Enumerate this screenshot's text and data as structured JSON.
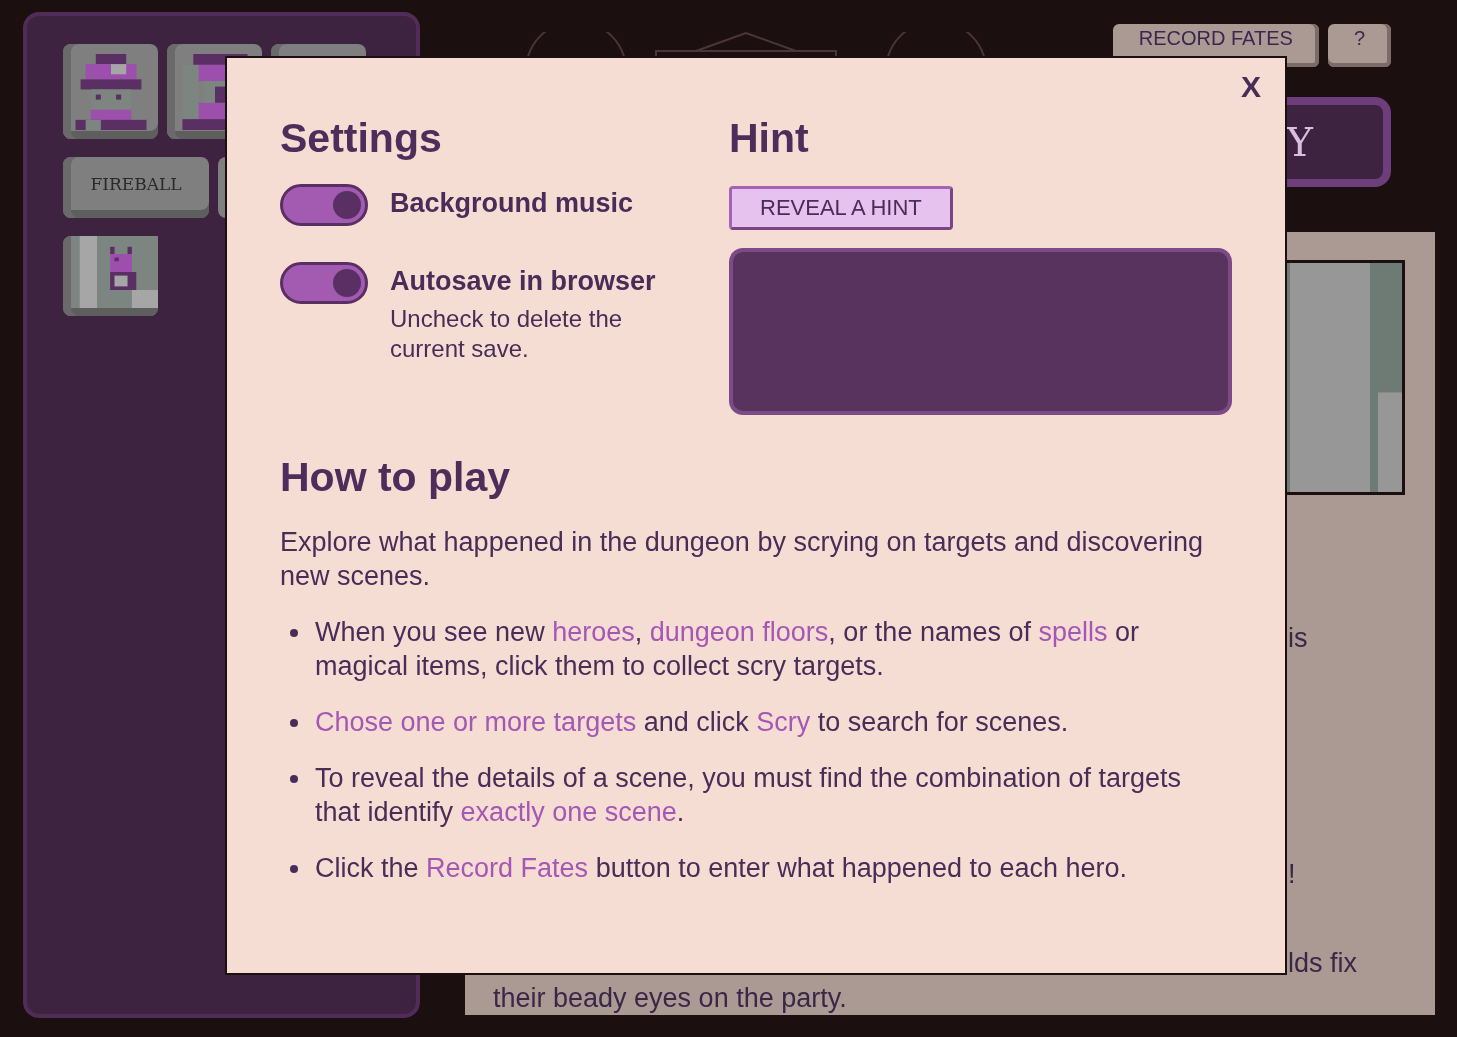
{
  "sidebar": {
    "hero_tiles": [
      {
        "kind": "mage"
      },
      {
        "kind": "knight"
      },
      {
        "kind": "blank"
      }
    ],
    "spell_buttons": [
      "FIREBALL"
    ],
    "scene_tiles": [
      {
        "kind": "cat"
      }
    ]
  },
  "top_buttons": [
    "RECORD FATES",
    "?"
  ],
  "scry_button": "Y",
  "story": {
    "fragments": [
      "is",
      "!",
      "lds fix"
    ],
    "last_line": "their beady eyes on the party."
  },
  "modal": {
    "close": "X",
    "settings": {
      "title": "Settings",
      "toggles": [
        {
          "label": "Background music",
          "on": true
        },
        {
          "label": "Autosave in browser",
          "on": true,
          "note": "Uncheck to delete the current save."
        }
      ]
    },
    "hint": {
      "title": "Hint",
      "button": "REVEAL A HINT"
    },
    "how_to_play": {
      "title": "How to play",
      "intro": "Explore what happened in the dungeon by scrying on targets and discovering new scenes.",
      "bullets": [
        [
          {
            "kind": "plain",
            "text": "When you see new "
          },
          {
            "kind": "link",
            "text": "heroes"
          },
          {
            "kind": "plain",
            "text": ", "
          },
          {
            "kind": "link",
            "text": "dungeon floors"
          },
          {
            "kind": "plain",
            "text": ", or the names of "
          },
          {
            "kind": "link",
            "text": "spells"
          },
          {
            "kind": "plain",
            "text": " or magical items, click them to collect scry targets."
          }
        ],
        [
          {
            "kind": "link",
            "text": "Chose one or more targets"
          },
          {
            "kind": "plain",
            "text": " and click "
          },
          {
            "kind": "link",
            "text": "Scry"
          },
          {
            "kind": "plain",
            "text": " to search for scenes."
          }
        ],
        [
          {
            "kind": "plain",
            "text": "To reveal the details of a scene, you must find the combination of targets that identify "
          },
          {
            "kind": "link",
            "text": "exactly one scene"
          },
          {
            "kind": "plain",
            "text": "."
          }
        ],
        [
          {
            "kind": "plain",
            "text": "Click the "
          },
          {
            "kind": "link",
            "text": "Record Fates"
          },
          {
            "kind": "plain",
            "text": " button to enter what happened to each hero."
          }
        ]
      ]
    }
  }
}
